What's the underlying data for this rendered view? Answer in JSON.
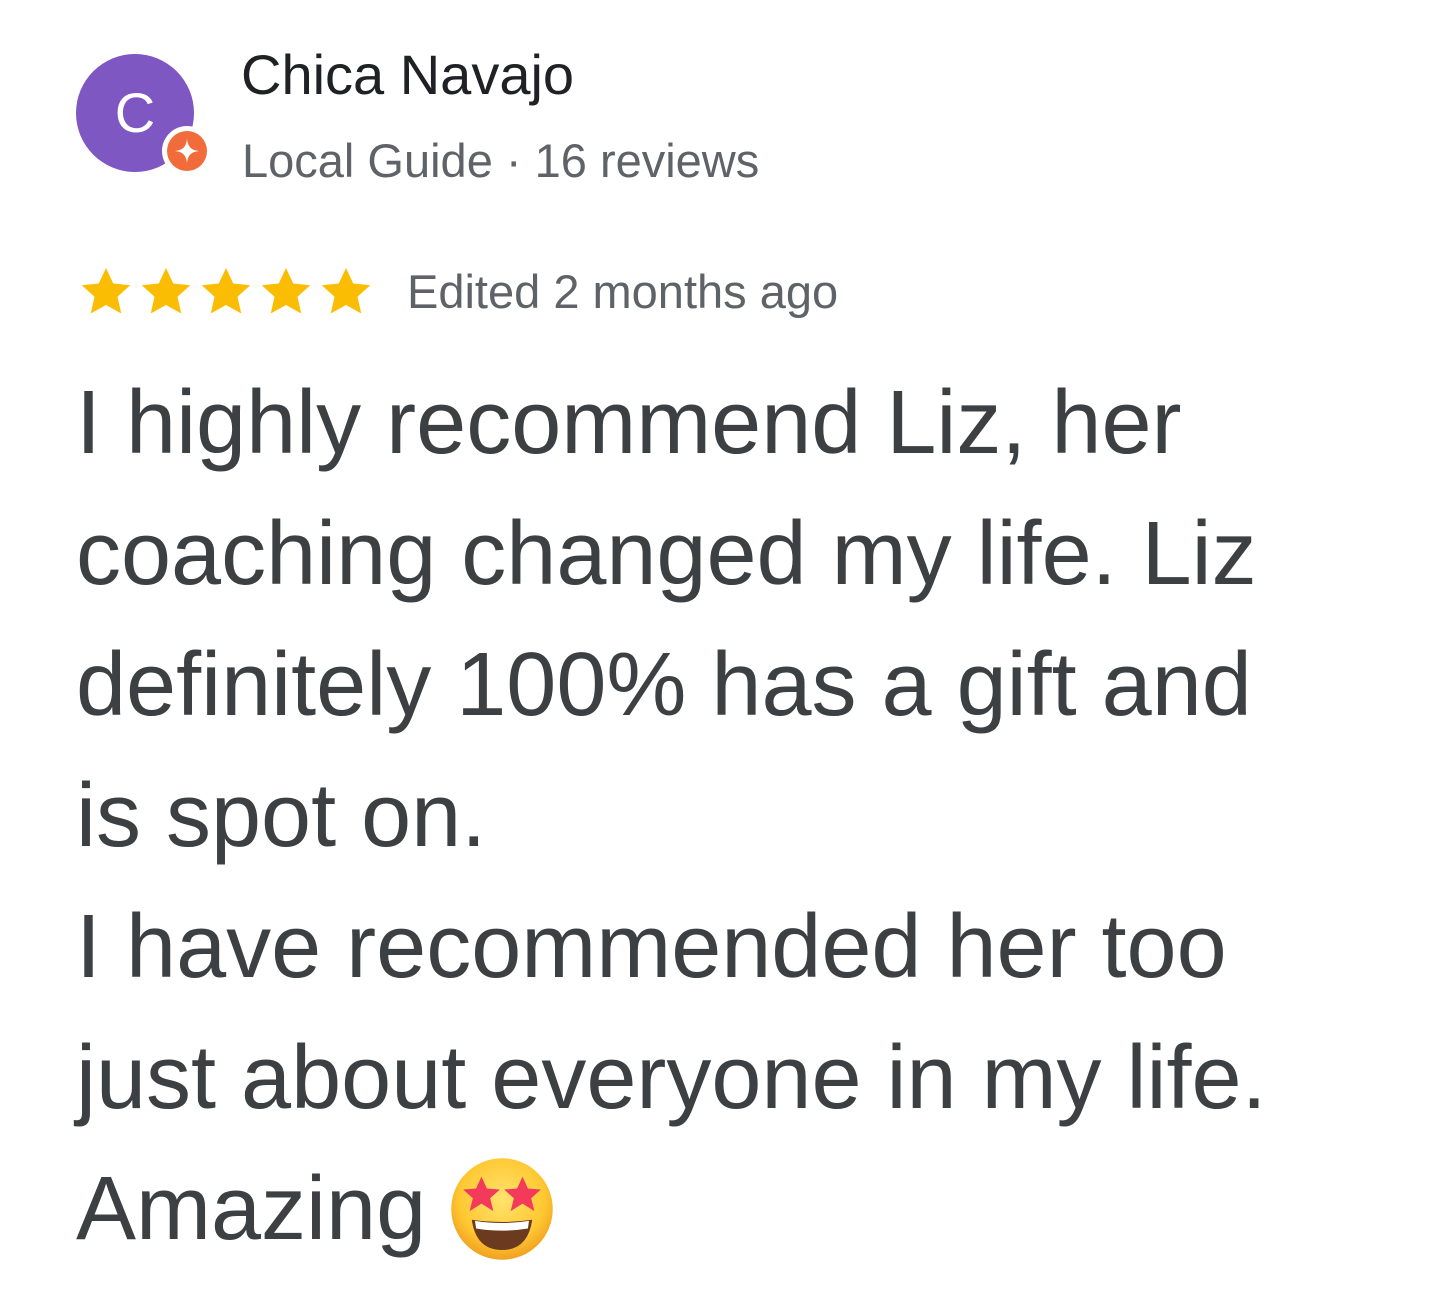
{
  "reviewer": {
    "avatar_initial": "C",
    "name": "Chica Navajo",
    "meta": "Local Guide · 16 reviews",
    "avatar_color": "#7e57c2",
    "badge_color": "#f26b3a"
  },
  "review": {
    "rating": 5,
    "max_rating": 5,
    "star_color": "#fbbc04",
    "date": "Edited 2 months ago",
    "lines": [
      "I highly recommend Liz, her",
      "coaching changed my life. Liz",
      "definitely 100% has a gift and",
      "is spot on.",
      "I have recommended her too",
      "just about everyone in my life.",
      "Amazing"
    ],
    "trailing_emoji": "star-struck-emoji-icon"
  }
}
